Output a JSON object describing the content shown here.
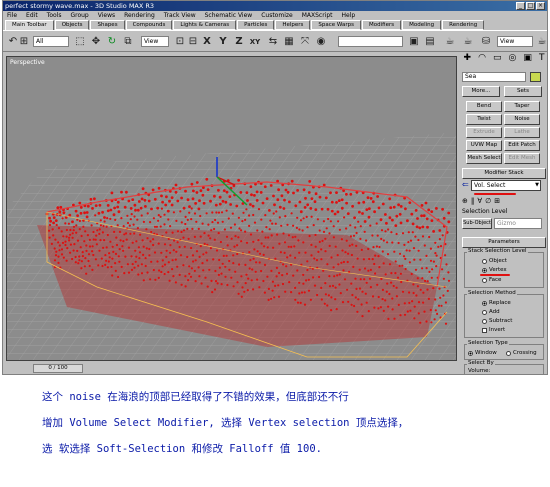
{
  "window": {
    "title": "perfect stormy wave.max - 3D Studio MAX R3",
    "buttons": [
      "_",
      "□",
      "×"
    ]
  },
  "menus": [
    "File",
    "Edit",
    "Tools",
    "Group",
    "Views",
    "Rendering",
    "Track View",
    "Schematic View",
    "Customize",
    "MAXScript",
    "Help"
  ],
  "tabs": [
    "Main Toolbar",
    "Objects",
    "Shapes",
    "Compounds",
    "Lights & Cameras",
    "Particles",
    "Helpers",
    "Space Warps",
    "Modifiers",
    "Modeling",
    "Rendering"
  ],
  "toolbar": {
    "filter_value": "All",
    "refcoord_value": "View",
    "view_value": "View",
    "axes": [
      "X",
      "Y",
      "Z",
      "XY"
    ]
  },
  "viewport": {
    "label": "Perspective"
  },
  "status": {
    "frame": "0 / 100"
  },
  "command_panel": {
    "tab_icons": [
      "✚",
      "◠",
      "▭",
      "◎",
      "▣",
      "T"
    ],
    "name": "Sea",
    "more_label": "More...",
    "sets_label": "Sets",
    "modifiers": [
      "Bend",
      "Taper",
      "Twist",
      "Noise",
      "Extrude",
      "Lathe",
      "UVW Map",
      "Edit Patch",
      "Mesh Select",
      "Edit Mesh"
    ],
    "modifier_stack_title": "Modifier Stack",
    "stack_value": "Vol. Select",
    "selection_level_title": "Selection Level",
    "sub_object_label": "Sub-Object",
    "sub_object_value": "Gizmo",
    "parameters_title": "Parameters",
    "stack_selection_level": {
      "label": "Stack Selection Level",
      "options": [
        "Object",
        "Vertex",
        "Face"
      ],
      "selected": "Vertex"
    },
    "selection_method": {
      "label": "Selection Method",
      "options": [
        "Replace",
        "Add",
        "Subtract"
      ],
      "selected": "Replace",
      "invert_label": "Invert"
    },
    "selection_type": {
      "label": "Selection Type",
      "options": [
        "Window",
        "Crossing"
      ],
      "selected": "Window"
    },
    "select_by": {
      "label": "Select By",
      "value_label": "Volume:"
    }
  },
  "caption": {
    "line1": "这个 noise 在海浪的顶部已经取得了不错的效果，但底部还不行",
    "line2": "增加 Volume Select Modifier, 选择 Vertex selection 顶点选择，",
    "line3": "选 软选择 Soft-Selection 和修改 Falloff 值 100."
  },
  "colors": {
    "title_bar": "#0a246a",
    "annotation_red": "#e01010",
    "caption_blue": "#0a1aa8",
    "wave_red": "#dd1111"
  }
}
